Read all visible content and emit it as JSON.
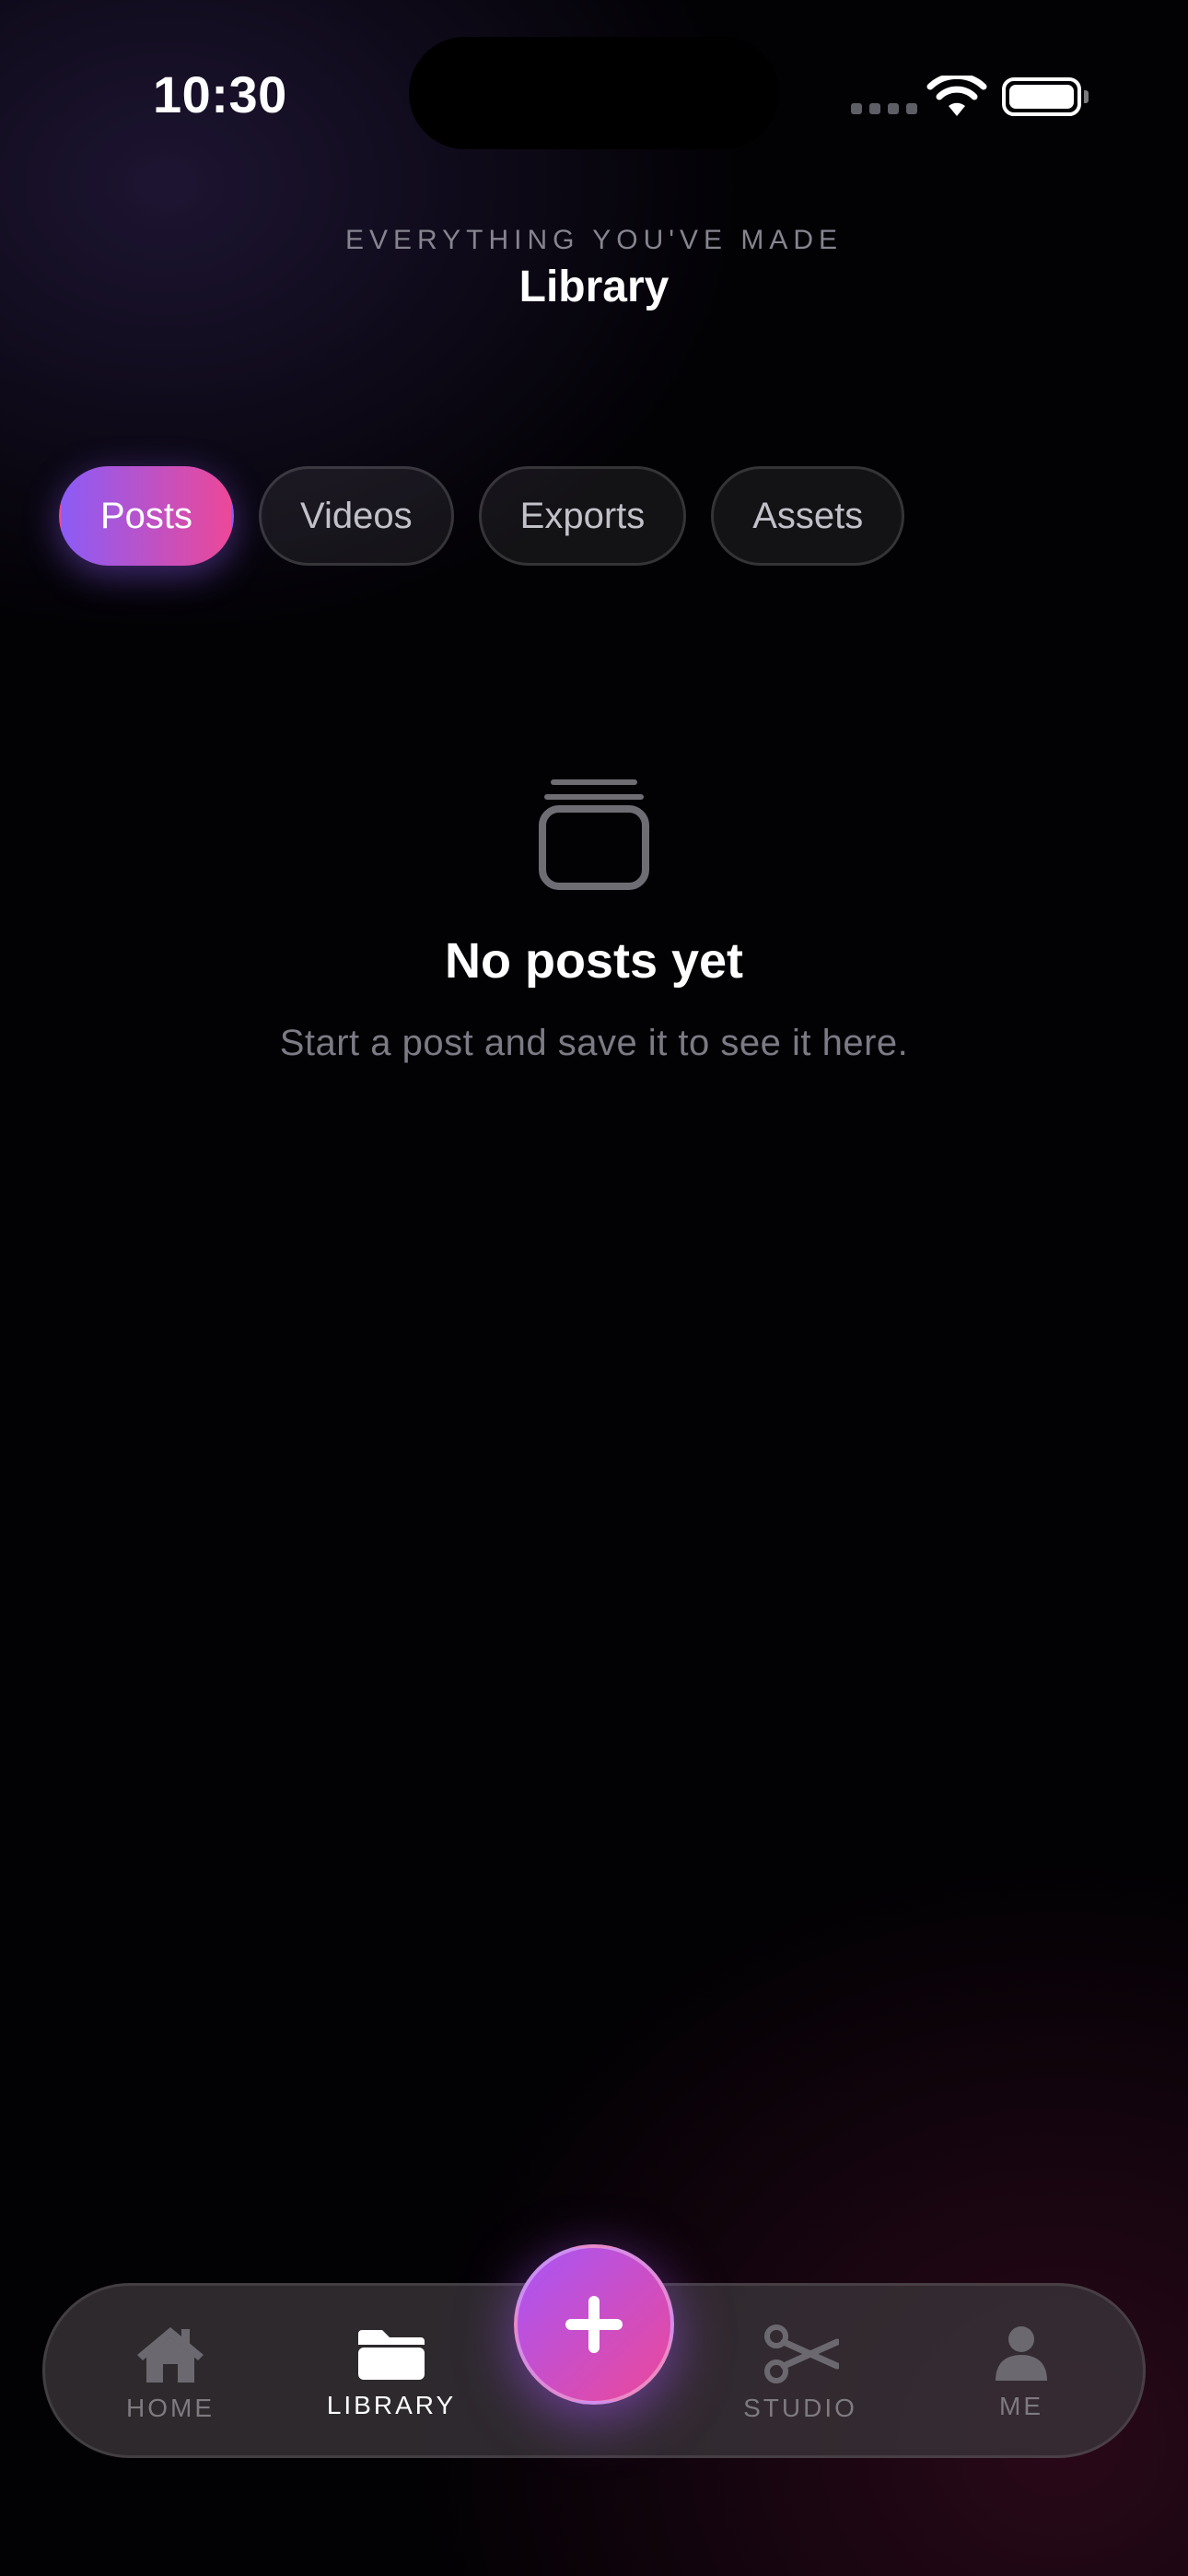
{
  "status_bar": {
    "time": "10:30"
  },
  "header": {
    "eyebrow": "EVERYTHING YOU'VE MADE",
    "title": "Library"
  },
  "tabs": [
    {
      "label": "Posts",
      "active": true
    },
    {
      "label": "Videos",
      "active": false
    },
    {
      "label": "Exports",
      "active": false
    },
    {
      "label": "Assets",
      "active": false
    }
  ],
  "empty_state": {
    "icon": "stack-icon",
    "title": "No posts yet",
    "subtitle": "Start a post and save it to see it here."
  },
  "nav": {
    "items": [
      {
        "label": "HOME",
        "icon": "house-icon",
        "active": false
      },
      {
        "label": "LIBRARY",
        "icon": "folder-icon",
        "active": true
      },
      {
        "label": "STUDIO",
        "icon": "scissors-icon",
        "active": false
      },
      {
        "label": "ME",
        "icon": "person-icon",
        "active": false
      }
    ],
    "create_icon": "plus-icon"
  },
  "colors": {
    "accent_start": "#8b5cf6",
    "accent_end": "#ec4899",
    "text_muted": "#7c7a84",
    "background": "#020104"
  }
}
